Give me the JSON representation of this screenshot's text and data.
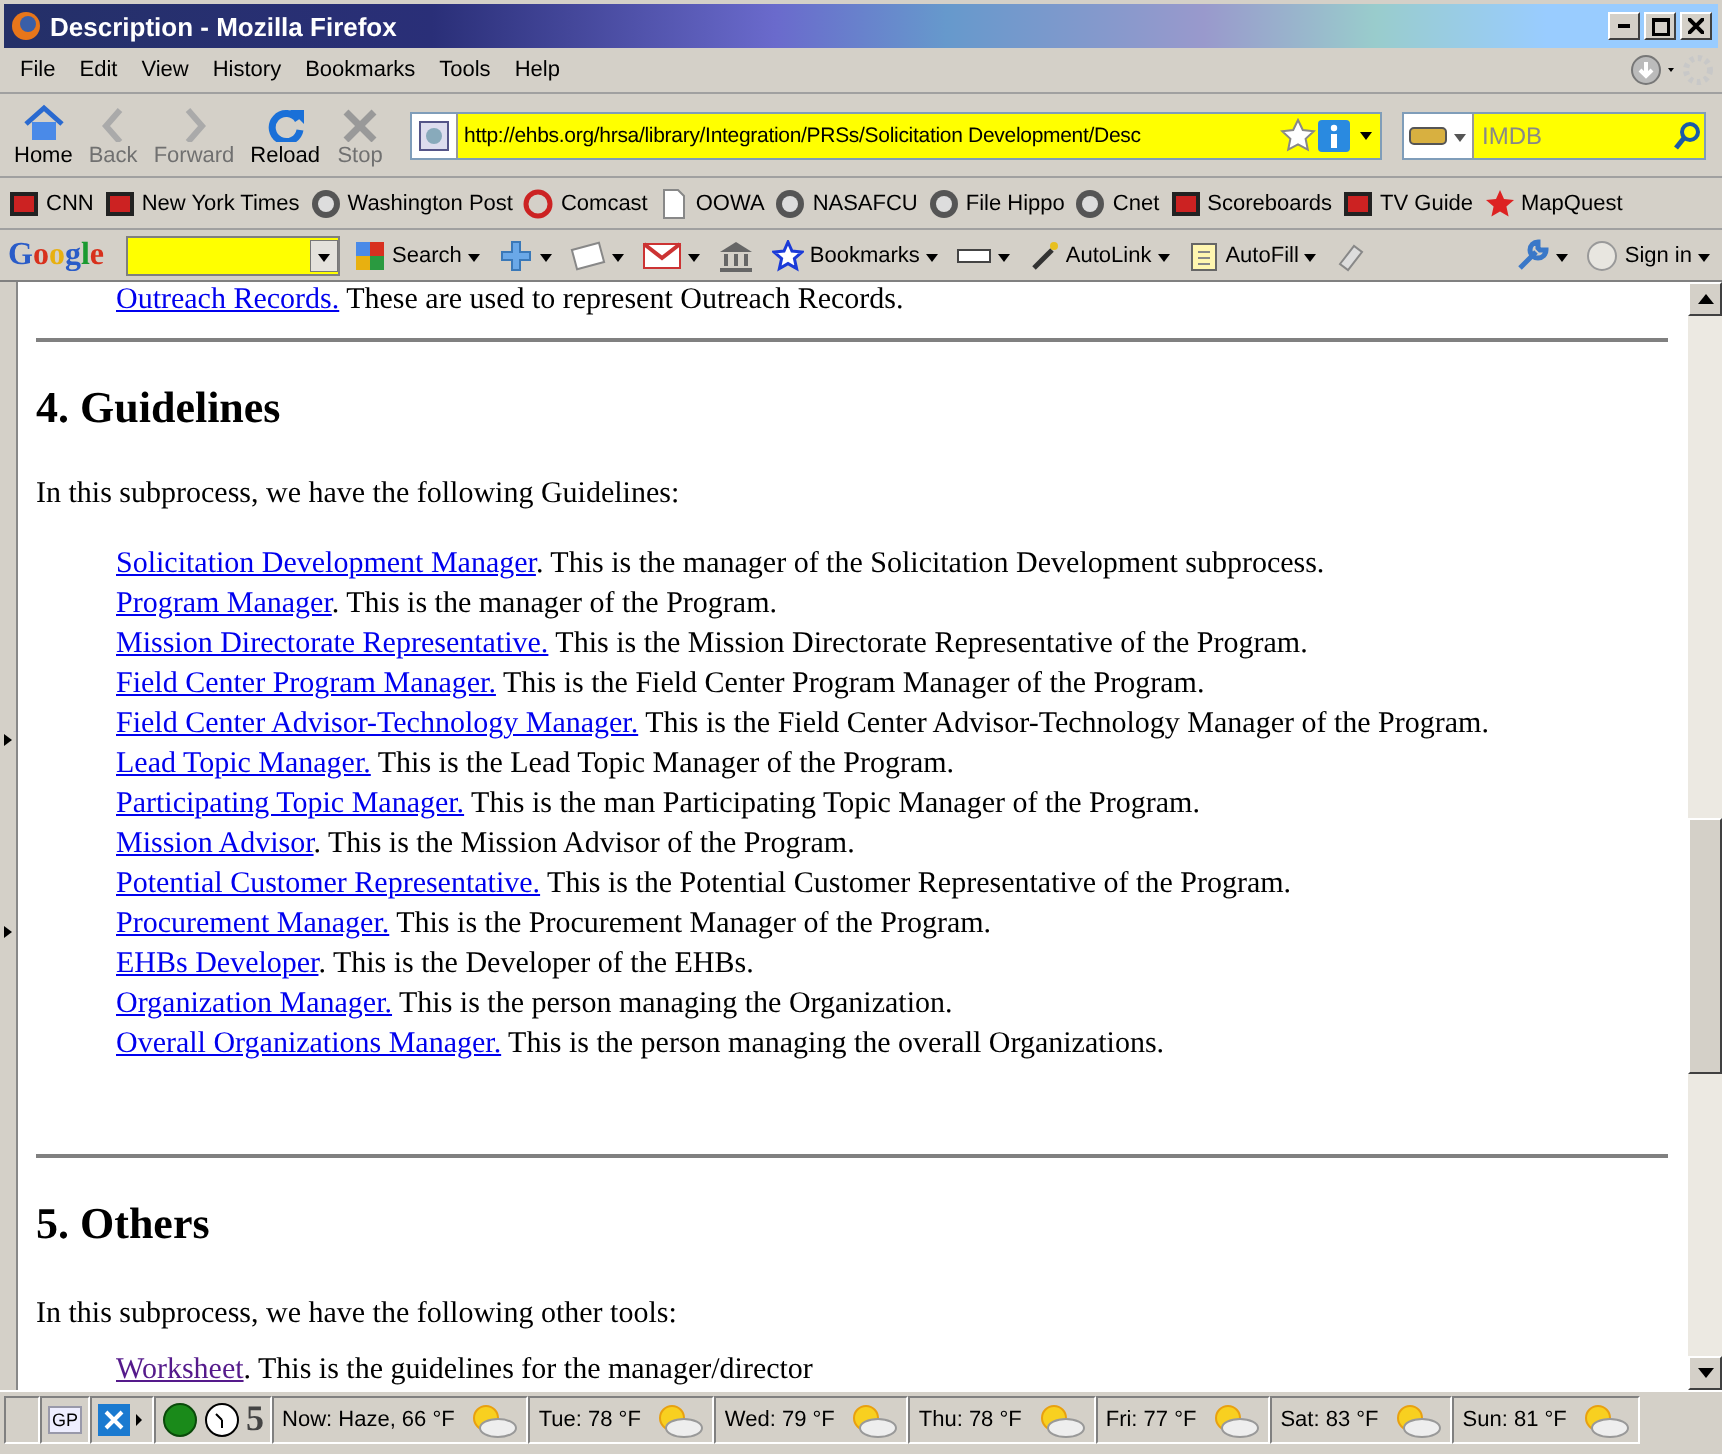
{
  "window": {
    "title": "Description - Mozilla Firefox"
  },
  "menu": [
    "File",
    "Edit",
    "View",
    "History",
    "Bookmarks",
    "Tools",
    "Help"
  ],
  "nav_buttons": [
    {
      "kind": "home",
      "label": "Home",
      "disabled": false
    },
    {
      "kind": "back",
      "label": "Back",
      "disabled": true
    },
    {
      "kind": "forward",
      "label": "Forward",
      "disabled": true
    },
    {
      "kind": "reload",
      "label": "Reload",
      "disabled": false
    },
    {
      "kind": "stop",
      "label": "Stop",
      "disabled": true
    }
  ],
  "address": {
    "value": "http://ehbs.org/hrsa/library/Integration/PRSs/Solicitation Development/Desc"
  },
  "search": {
    "placeholder": "IMDB"
  },
  "bookmarks": [
    {
      "kind": "square",
      "label": "CNN"
    },
    {
      "kind": "square",
      "label": "New York Times"
    },
    {
      "kind": "circle",
      "label": "Washington Post"
    },
    {
      "kind": "ring",
      "label": "Comcast"
    },
    {
      "kind": "page",
      "label": "OOWA"
    },
    {
      "kind": "circle",
      "label": "NASAFCU"
    },
    {
      "kind": "circle",
      "label": "File Hippo"
    },
    {
      "kind": "circle",
      "label": "Cnet"
    },
    {
      "kind": "square",
      "label": "Scoreboards"
    },
    {
      "kind": "square",
      "label": "TV Guide"
    },
    {
      "kind": "star",
      "label": "MapQuest"
    }
  ],
  "google_toolbar": {
    "logo": "Google",
    "search_label": "Search",
    "bookmarks_label": "Bookmarks",
    "autolink_label": "AutoLink",
    "autofill_label": "AutoFill",
    "sign_in_label": "Sign in"
  },
  "page": {
    "top_item": {
      "link": "Outreach Records.",
      "text": " These are used to represent Outreach Records.",
      "visited": false
    },
    "sections": [
      {
        "heading": "4. Guidelines",
        "intro": "In this subprocess, we have the following Guidelines:",
        "items": [
          {
            "link": "Solicitation Development Manager",
            "text": ". This is the manager of the Solicitation Development subprocess.",
            "visited": false
          },
          {
            "link": "Program Manager",
            "text": ". This is the manager of the Program.",
            "visited": false
          },
          {
            "link": "Mission Directorate Representative.",
            "text": " This is the Mission Directorate Representative of the Program.",
            "visited": false
          },
          {
            "link": "Field Center Program Manager.",
            "text": " This is the Field Center Program Manager of the Program.",
            "visited": false
          },
          {
            "link": "Field Center Advisor-Technology Manager.",
            "text": " This is the Field Center Advisor-Technology Manager of the Program.",
            "visited": false
          },
          {
            "link": "Lead Topic Manager.",
            "text": " This is the Lead Topic Manager of the Program.",
            "visited": false
          },
          {
            "link": "Participating Topic Manager.",
            "text": " This is the man Participating Topic Manager of the Program.",
            "visited": false
          },
          {
            "link": "Mission Advisor",
            "text": ". This is the Mission Advisor of the Program.",
            "visited": false
          },
          {
            "link": "Potential Customer Representative.",
            "text": " This is the Potential Customer Representative of the Program.",
            "visited": false
          },
          {
            "link": "Procurement Manager.",
            "text": " This is the Procurement Manager of the Program.",
            "visited": false
          },
          {
            "link": "EHBs Developer",
            "text": ". This is the Developer of the EHBs.",
            "visited": false
          },
          {
            "link": "Organization Manager.",
            "text": " This is the person managing the Organization.",
            "visited": false
          },
          {
            "link": "Overall Organizations Manager.",
            "text": " This is the person managing the overall Organizations.",
            "visited": false
          }
        ]
      },
      {
        "heading": "5. Others",
        "intro": "In this subprocess, we have the following other tools:",
        "items": [
          {
            "link": "Worksheet",
            "text": ". This is the guidelines for the manager/director",
            "visited": true
          }
        ]
      }
    ]
  },
  "status_bar": {
    "badge": "GP",
    "count": "5",
    "weather": [
      "Now: Haze, 66 °F",
      "Tue: 78 °F",
      "Wed: 79 °F",
      "Thu: 78 °F",
      "Fri: 77 °F",
      "Sat: 83 °F",
      "Sun: 81 °F"
    ]
  }
}
